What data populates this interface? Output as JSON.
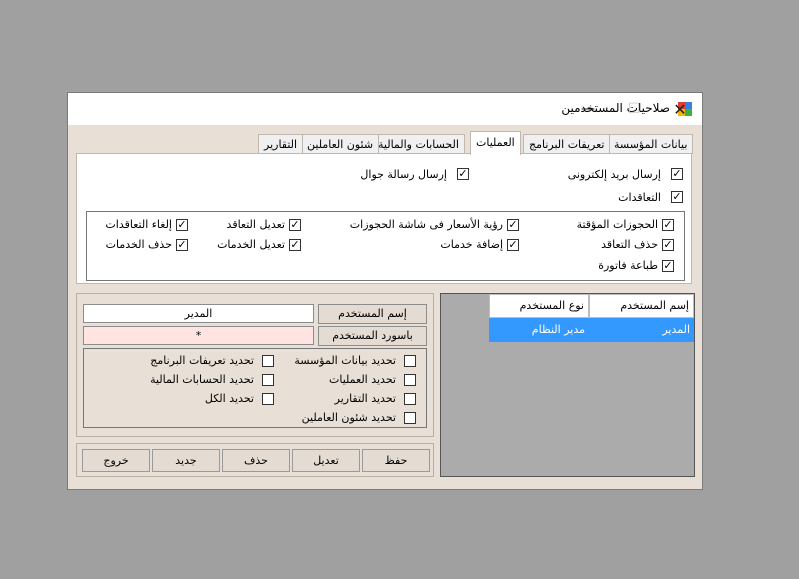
{
  "window": {
    "title": "صلاحيات المستخدمين",
    "minimize_glyph": "—",
    "maximize_glyph": "☐",
    "close_glyph": "✕"
  },
  "tabs": [
    {
      "label": "بيانات المؤسسة",
      "active": false
    },
    {
      "label": "تعريفات البرنامج",
      "active": false
    },
    {
      "label": "العمليات",
      "active": true
    },
    {
      "label": "الحسابات والمالية",
      "active": false
    },
    {
      "label": "شئون العاملين",
      "active": false
    },
    {
      "label": "التقارير",
      "active": false
    }
  ],
  "operations": {
    "top": [
      {
        "label": "إرسال بريد إلكترونى",
        "checked": true
      },
      {
        "label": "إرسال رسالة جوال",
        "checked": true
      },
      {
        "label": "التعاقدات",
        "checked": true
      }
    ],
    "group": [
      {
        "label": "الحجوزات المؤقتة",
        "checked": true
      },
      {
        "label": "رؤية الأسعار فى شاشة الحجوزات",
        "checked": true
      },
      {
        "label": "تعديل التعاقد",
        "checked": true
      },
      {
        "label": "إلغاء التعاقدات",
        "checked": true
      },
      {
        "label": "حذف التعاقد",
        "checked": true
      },
      {
        "label": "إضافة خدمات",
        "checked": true
      },
      {
        "label": "تعديل الخدمات",
        "checked": true
      },
      {
        "label": "حذف الخدمات",
        "checked": true
      },
      {
        "label": "طباعة فاتورة",
        "checked": true
      }
    ]
  },
  "user_form": {
    "username_label": "إسم المستخدم",
    "username_value": "المدير",
    "password_label": "باسورد المستخدم",
    "password_value": "*"
  },
  "select_all": [
    {
      "label": "تحديد بيانات المؤسسة",
      "checked": false
    },
    {
      "label": "تحديد تعريفات البرنامج",
      "checked": false
    },
    {
      "label": "تحديد العمليات",
      "checked": false
    },
    {
      "label": "تحديد الحسابات المالية",
      "checked": false
    },
    {
      "label": "تحديد التقارير",
      "checked": false
    },
    {
      "label": "تحديد الكل",
      "checked": false
    },
    {
      "label": "تحديد شئون العاملين",
      "checked": false
    }
  ],
  "buttons": {
    "save": "حفظ",
    "edit": "تعديل",
    "delete": "حذف",
    "new": "جديد",
    "exit": "خروج"
  },
  "grid": {
    "columns": [
      "إسم المستخدم",
      "نوع المستخدم"
    ],
    "rows": [
      [
        "المدير",
        "مدير النظام"
      ]
    ]
  },
  "colors": {
    "selection": "#3399ff",
    "password_field_bg": "#ffe4e1",
    "window_bg": "#e8e0d6"
  }
}
